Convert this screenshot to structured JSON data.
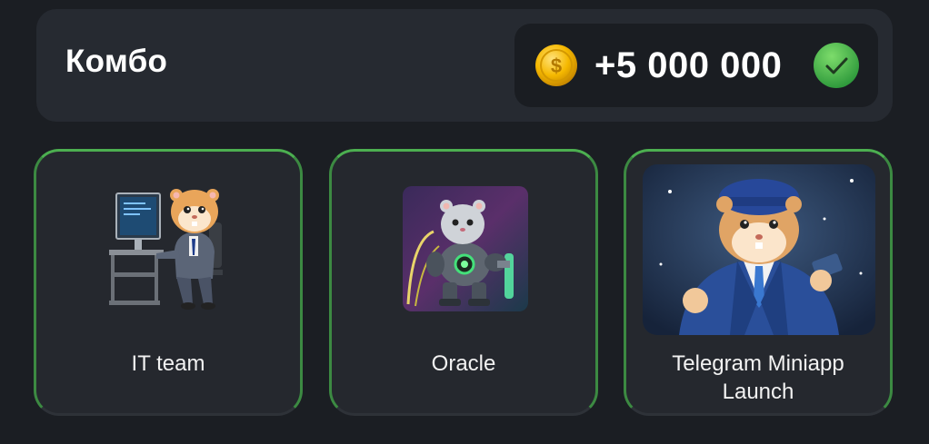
{
  "combo": {
    "title": "Комбо",
    "reward": "+5 000 000",
    "coin_icon": "gold-dollar-coin-icon",
    "status_icon": "green-check-icon",
    "status_color": "#3fb34f"
  },
  "cards": [
    {
      "label": "IT team",
      "image": "hamster-at-computer-desk"
    },
    {
      "label": "Oracle",
      "image": "robot-armored-hamster"
    },
    {
      "label": "Telegram Miniapp Launch",
      "label_lines": [
        "Telegram Miniapp",
        "Launch"
      ],
      "image": "hamster-in-blue-suit-with-phone"
    }
  ],
  "colors": {
    "background": "#1b1e23",
    "panel": "#262a31",
    "card_border": "#4caf50",
    "coin": "#f5b800"
  }
}
